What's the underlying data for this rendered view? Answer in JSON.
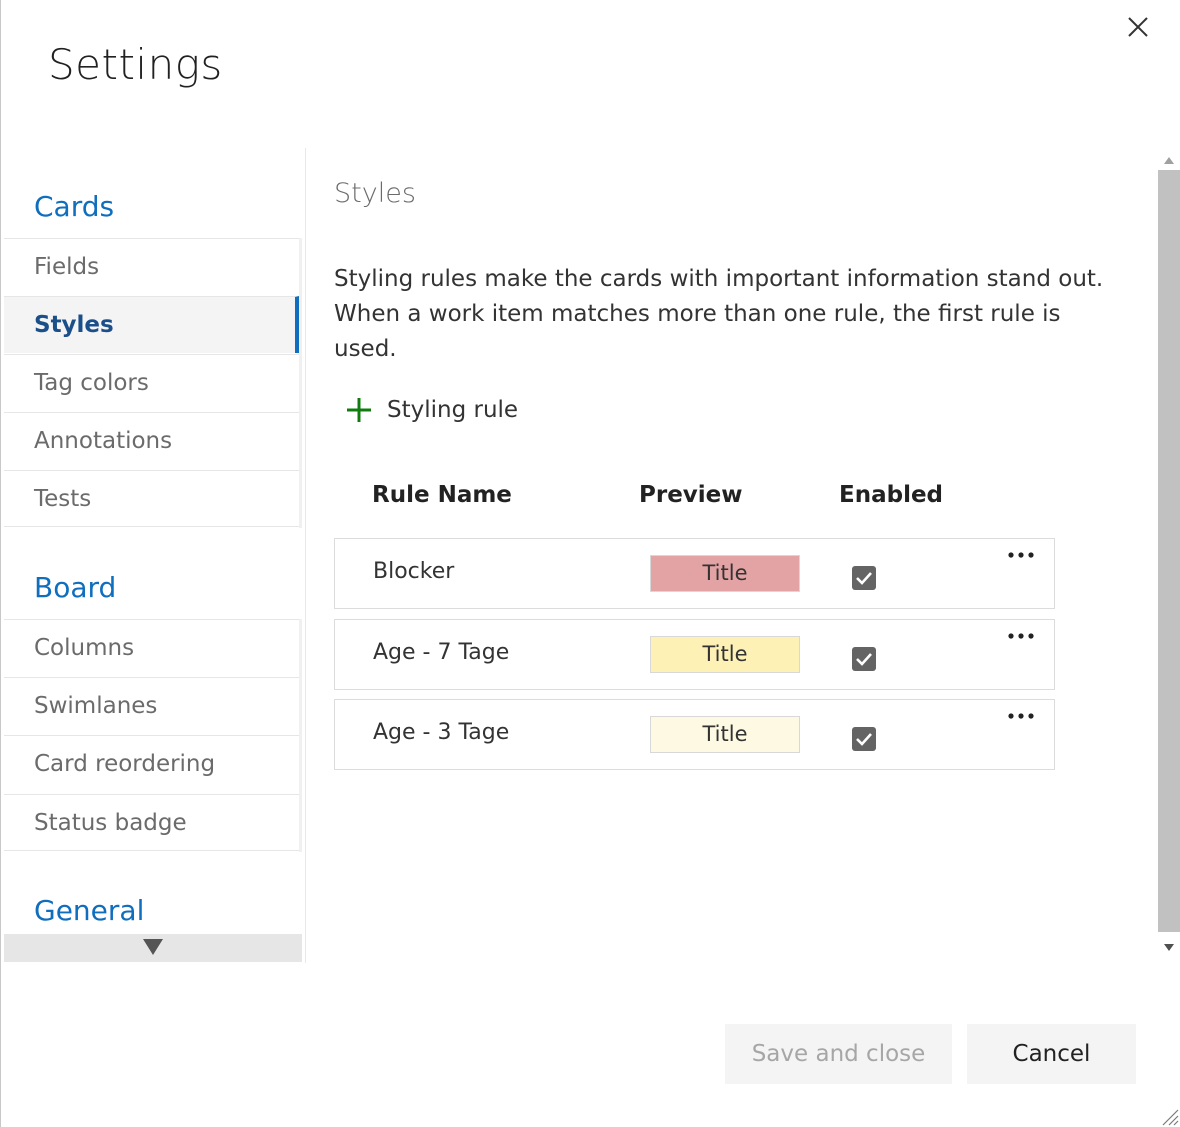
{
  "dialog": {
    "title": "Settings",
    "close_icon": "close-icon"
  },
  "sidebar": {
    "groups": [
      {
        "label": "Cards",
        "items": [
          {
            "label": "Fields",
            "selected": false
          },
          {
            "label": "Styles",
            "selected": true
          },
          {
            "label": "Tag colors",
            "selected": false
          },
          {
            "label": "Annotations",
            "selected": false
          },
          {
            "label": "Tests",
            "selected": false
          }
        ]
      },
      {
        "label": "Board",
        "items": [
          {
            "label": "Columns",
            "selected": false
          },
          {
            "label": "Swimlanes",
            "selected": false
          },
          {
            "label": "Card reordering",
            "selected": false
          },
          {
            "label": "Status badge",
            "selected": false
          }
        ]
      },
      {
        "label": "General",
        "items": []
      }
    ],
    "scroll_icon": "triangle-down-icon"
  },
  "content": {
    "heading": "Styles",
    "description": "Styling rules make the cards with important information stand out. When a work item matches more than one rule, the first rule is used.",
    "add_rule_label": "Styling rule",
    "add_rule_icon": "plus-icon",
    "add_rule_icon_color": "#107c10",
    "columns": {
      "rule_name": "Rule Name",
      "preview": "Preview",
      "enabled": "Enabled"
    },
    "rules": [
      {
        "name": "Blocker",
        "preview_text": "Title",
        "preview_color": "#e3a3a4",
        "enabled": true
      },
      {
        "name": "Age - 7 Tage",
        "preview_text": "Title",
        "preview_color": "#fdf1b6",
        "enabled": true
      },
      {
        "name": "Age - 3 Tage",
        "preview_text": "Title",
        "preview_color": "#fef9e2",
        "enabled": true
      }
    ],
    "more_icon": "ellipsis-icon",
    "check_icon": "checkbox-checked-icon"
  },
  "footer": {
    "save_label": "Save and close",
    "cancel_label": "Cancel"
  },
  "colors": {
    "accent": "#106ebe",
    "selected_nav_text": "#1b4f8a"
  }
}
